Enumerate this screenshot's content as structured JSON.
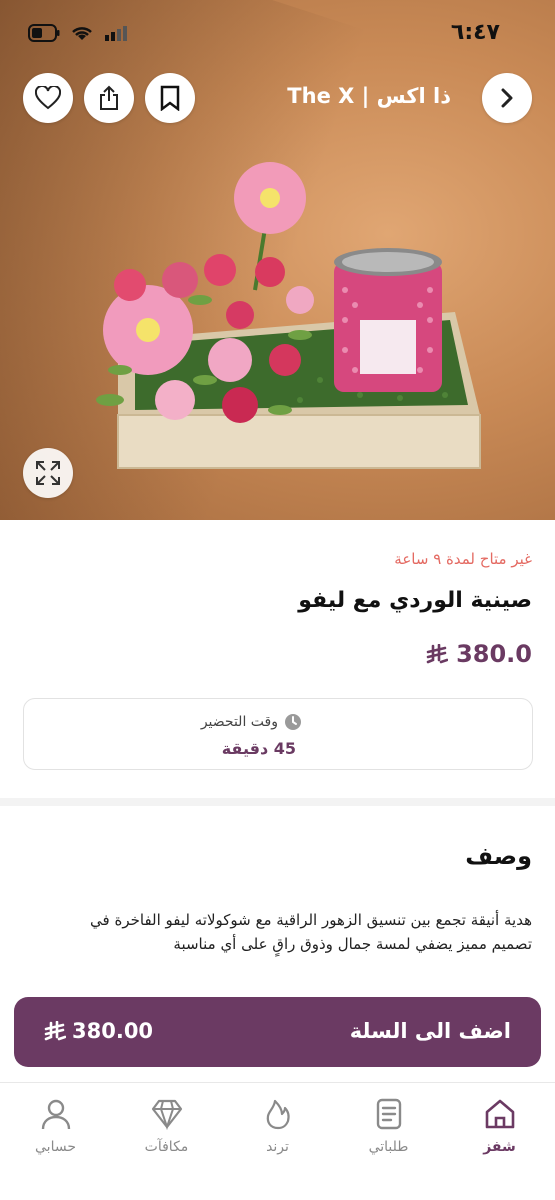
{
  "status_bar": {
    "time": "٦:٤٧"
  },
  "header": {
    "store_name": "The X | ذا اكس"
  },
  "product": {
    "availability": "غير متاح لمدة ٩ ساعة",
    "title": "صينية الوردي مع ليفو",
    "price": "380.0",
    "currency_symbol": "⃁"
  },
  "prep": {
    "label": "وقت التحضير",
    "value": "45 دقيقة"
  },
  "description": {
    "title": "وصف",
    "body": "هدية أنيقة تجمع بين تنسيق الزهور الراقية مع شوكولاته ليفو الفاخرة في تصميم مميز يضفي لمسة جمال وذوق راقٍ على أي مناسبة"
  },
  "cart": {
    "label": "اضف الى السلة",
    "price": "380.00"
  },
  "bottom_nav": {
    "items": [
      {
        "label": "شفز",
        "icon": "home-icon",
        "active": true
      },
      {
        "label": "طلباتي",
        "icon": "orders-icon",
        "active": false
      },
      {
        "label": "ترند",
        "icon": "flame-icon",
        "active": false
      },
      {
        "label": "مكافآت",
        "icon": "diamond-icon",
        "active": false
      },
      {
        "label": "حسابي",
        "icon": "person-icon",
        "active": false
      }
    ]
  },
  "colors": {
    "accent": "#6b3a63",
    "warning": "#e46a62"
  }
}
